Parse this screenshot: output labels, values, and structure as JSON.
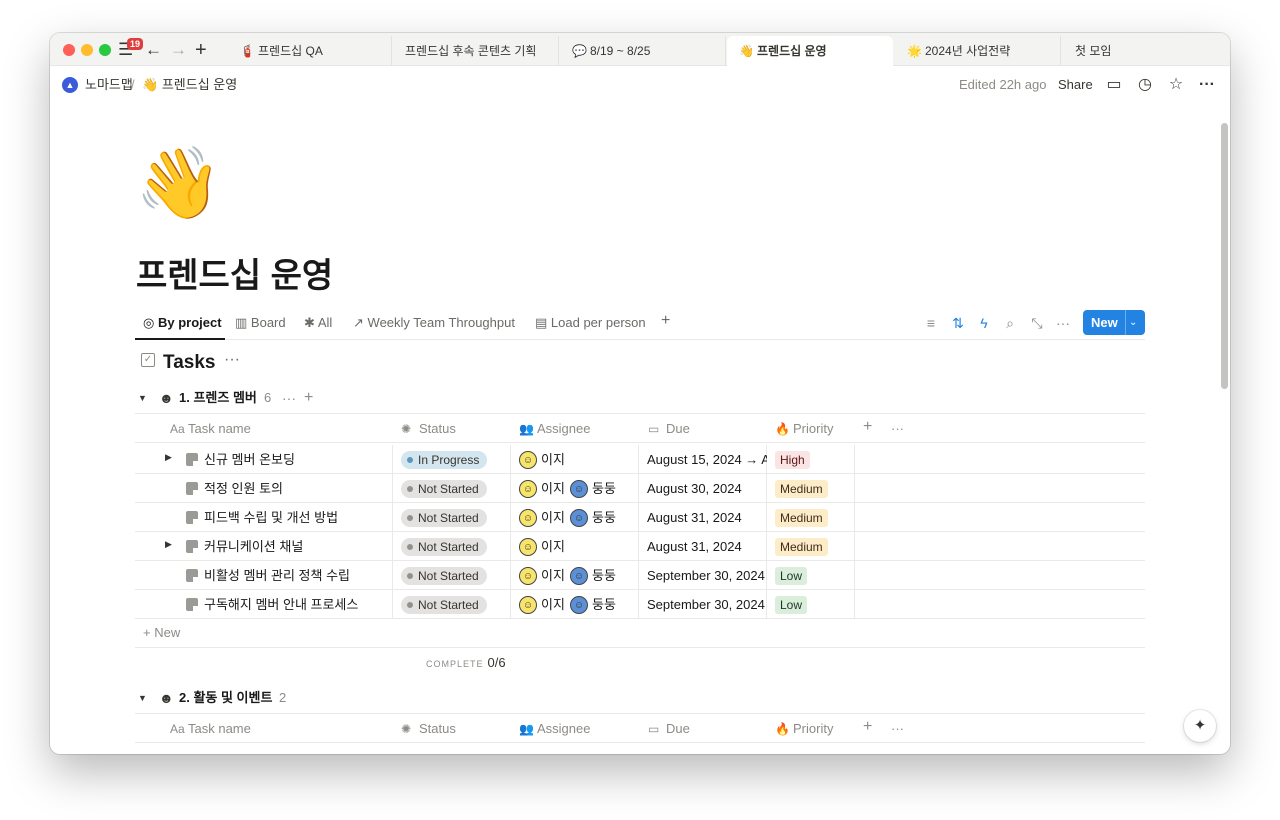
{
  "colors": {
    "accent": "#2383e2",
    "high": "#fbe4e4",
    "medium": "#fdecc8",
    "low": "#dbeddb",
    "in_progress": "#d3e5ef",
    "not_started": "#e3e2e0"
  },
  "tabbar": {
    "badge": "19",
    "tabs": [
      {
        "icon": "🧯",
        "label": "프렌드십 QA"
      },
      {
        "icon": "",
        "label": "프렌드십 후속 콘텐츠 기획"
      },
      {
        "icon": "💬",
        "label": "8/19 ~ 8/25"
      },
      {
        "icon": "👋",
        "label": "프렌드십 운영"
      },
      {
        "icon": "🌟",
        "label": "2024년 사업전략"
      },
      {
        "icon": "",
        "label": "첫 모임"
      }
    ]
  },
  "header": {
    "workspace": "노마드맵",
    "separator": "/",
    "page_icon": "👋",
    "page": "프렌드십 운영",
    "edited": "Edited 22h ago",
    "share": "Share"
  },
  "page": {
    "icon": "👋",
    "title": "프렌드십 운영"
  },
  "views": {
    "items": [
      {
        "icon": "◎",
        "label": "By project"
      },
      {
        "icon": "▥",
        "label": "Board"
      },
      {
        "icon": "✱",
        "label": "All"
      },
      {
        "icon": "↗",
        "label": "Weekly Team Throughput"
      },
      {
        "icon": "▤",
        "label": "Load per person"
      }
    ],
    "add": "+",
    "new_label": "New"
  },
  "database": {
    "title": "Tasks",
    "more": "···"
  },
  "columns": [
    {
      "icon": "Aa",
      "label": "Task name"
    },
    {
      "icon": "✺",
      "label": "Status"
    },
    {
      "icon": "👥",
      "label": "Assignee"
    },
    {
      "icon": "▭",
      "label": "Due"
    },
    {
      "icon": "🔥",
      "label": "Priority"
    }
  ],
  "groups": [
    {
      "face": "☻",
      "name": "1. 프렌즈 멤버",
      "count": "6"
    },
    {
      "face": "☻",
      "name": "2. 활동 및 이벤트",
      "count": "2"
    }
  ],
  "rows": [
    {
      "expand": "▶",
      "name": "신규 멤버 온보딩",
      "status": "In Progress",
      "assignees": [
        "이지"
      ],
      "due": "August 15, 2024 → A",
      "priority": "High"
    },
    {
      "expand": "",
      "name": "적정 인원 토의",
      "status": "Not Started",
      "assignees": [
        "이지",
        "둥둥"
      ],
      "due": "August 30, 2024",
      "priority": "Medium"
    },
    {
      "expand": "",
      "name": "피드백 수립 및 개선 방법",
      "status": "Not Started",
      "assignees": [
        "이지",
        "둥둥"
      ],
      "due": "August 31, 2024",
      "priority": "Medium"
    },
    {
      "expand": "▶",
      "name": "커뮤니케이션 채널",
      "status": "Not Started",
      "assignees": [
        "이지"
      ],
      "due": "August 31, 2024",
      "priority": "Medium"
    },
    {
      "expand": "",
      "name": "비활성 멤버 관리 정책 수립",
      "status": "Not Started",
      "assignees": [
        "이지",
        "둥둥"
      ],
      "due": "September 30, 2024",
      "priority": "Low"
    },
    {
      "expand": "",
      "name": "구독해지 멤버 안내 프로세스",
      "status": "Not Started",
      "assignees": [
        "이지",
        "둥둥"
      ],
      "due": "September 30, 2024",
      "priority": "Low"
    }
  ],
  "new_row": "+ New",
  "calculation": {
    "label": "COMPLETE",
    "value": "0/6"
  }
}
